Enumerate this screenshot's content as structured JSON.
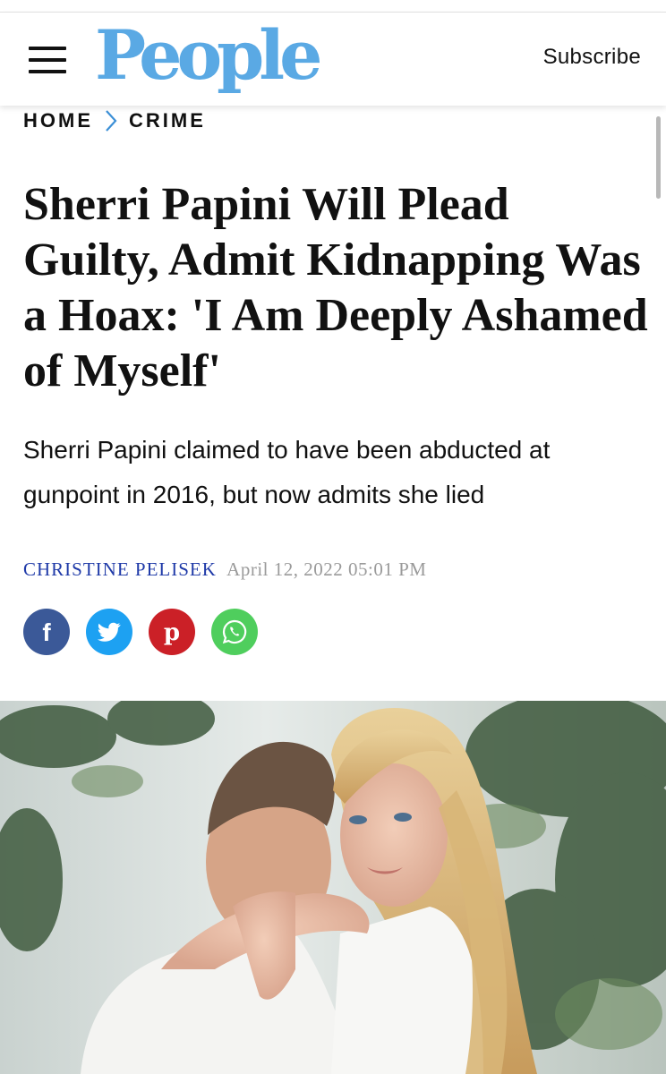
{
  "header": {
    "logo_text": "People",
    "subscribe_label": "Subscribe"
  },
  "breadcrumb": {
    "items": [
      "HOME",
      "CRIME"
    ]
  },
  "article": {
    "headline": "Sherri Papini Will Plead Guilty, Admit Kidnapping Was a Hoax: 'I Am Deeply Ashamed of Myself'",
    "dek": "Sherri Papini claimed to have been abducted at gunpoint in 2016, but now admits she lied",
    "author": "CHRISTINE PELISEK",
    "date": "April 12, 2022 05:01 PM"
  },
  "social": {
    "buttons": [
      {
        "name": "facebook",
        "icon": "facebook-icon",
        "color": "#3b5998"
      },
      {
        "name": "twitter",
        "icon": "twitter-icon",
        "color": "#1da1f2"
      },
      {
        "name": "pinterest",
        "icon": "pinterest-icon",
        "color": "#cb2027"
      },
      {
        "name": "whatsapp",
        "icon": "whatsapp-icon",
        "color": "#4fce5d"
      }
    ]
  },
  "colors": {
    "brand": "#5aa9e4",
    "chevron": "#3b8fd6",
    "author": "#1f3aa8",
    "date": "#9a9a9a"
  }
}
